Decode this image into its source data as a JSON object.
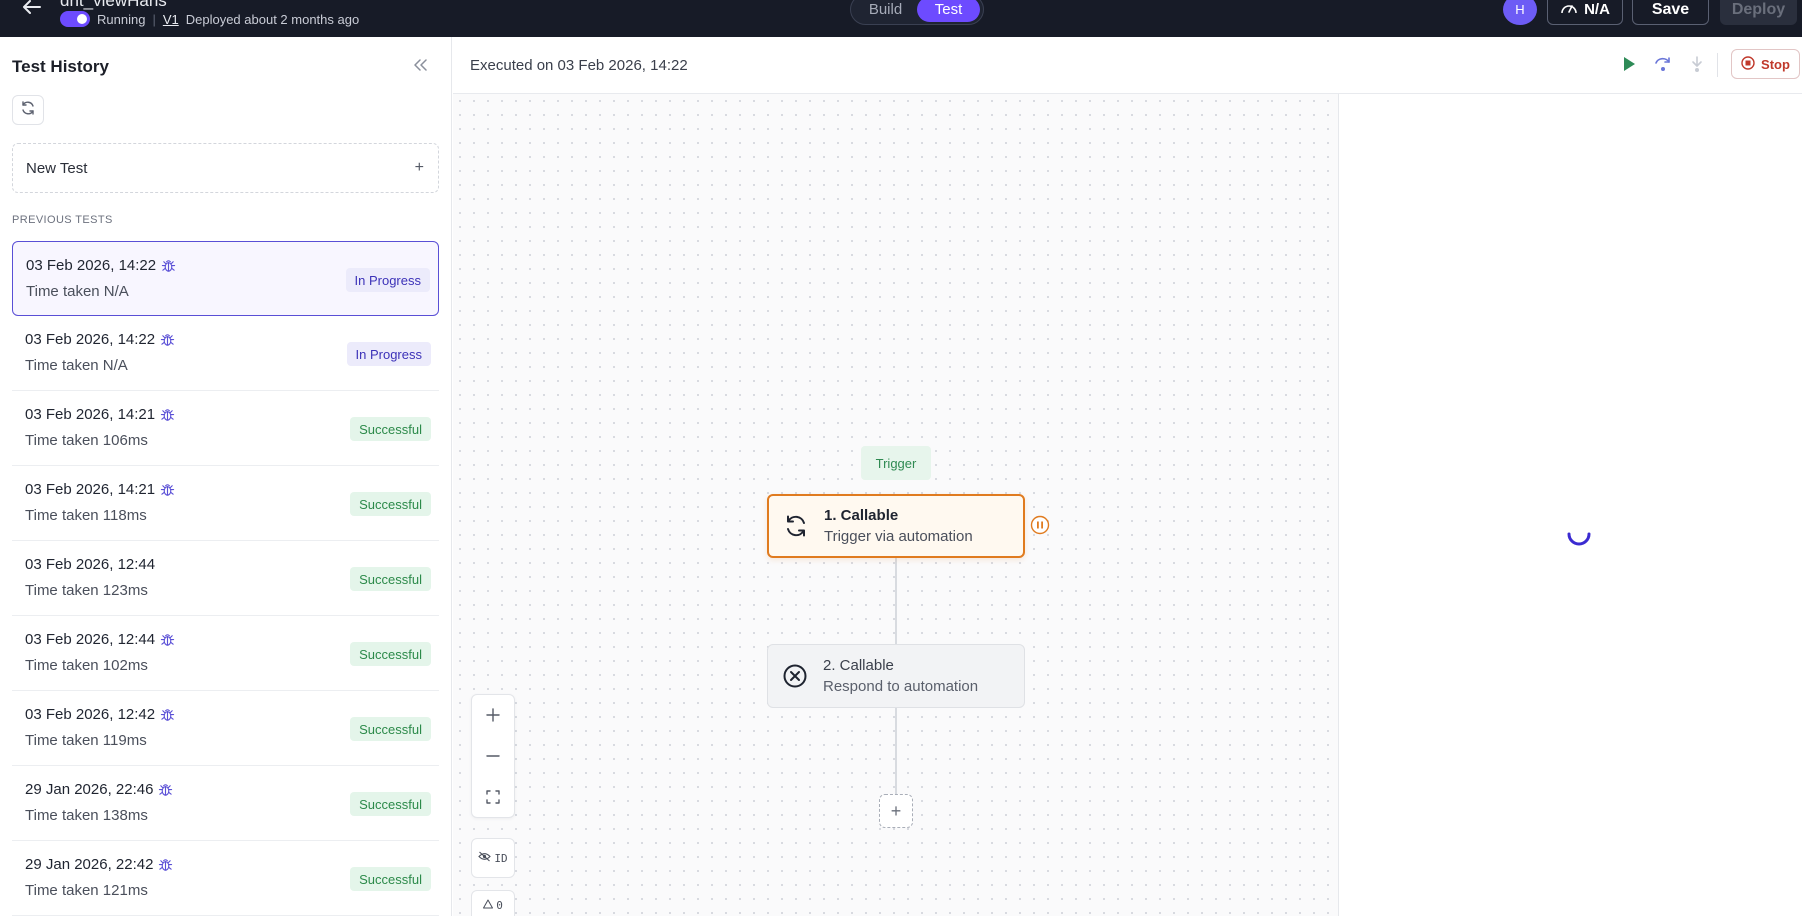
{
  "header": {
    "workflow_name": "dnt_viewHans",
    "status": "Running",
    "version": "V1",
    "deployed": "Deployed about 2 months ago",
    "tabs": [
      {
        "label": "Build",
        "active": false
      },
      {
        "label": "Test",
        "active": true
      }
    ],
    "avatar_initial": "H",
    "speed_label": "N/A",
    "save_label": "Save",
    "deploy_label": "Deploy",
    "accent_color": "#6d4bff"
  },
  "sidebar": {
    "title": "Test History",
    "new_test_label": "New Test",
    "section_label": "PREVIOUS TESTS",
    "tests": [
      {
        "date": "03 Feb 2026, 14:22",
        "time": "Time taken N/A",
        "status": "In Progress",
        "bug": true,
        "selected": true
      },
      {
        "date": "03 Feb 2026, 14:22",
        "time": "Time taken N/A",
        "status": "In Progress",
        "bug": true,
        "selected": false
      },
      {
        "date": "03 Feb 2026, 14:21",
        "time": "Time taken 106ms",
        "status": "Successful",
        "bug": true,
        "selected": false
      },
      {
        "date": "03 Feb 2026, 14:21",
        "time": "Time taken 118ms",
        "status": "Successful",
        "bug": true,
        "selected": false
      },
      {
        "date": "03 Feb 2026, 12:44",
        "time": "Time taken 123ms",
        "status": "Successful",
        "bug": false,
        "selected": false
      },
      {
        "date": "03 Feb 2026, 12:44",
        "time": "Time taken 102ms",
        "status": "Successful",
        "bug": true,
        "selected": false
      },
      {
        "date": "03 Feb 2026, 12:42",
        "time": "Time taken 119ms",
        "status": "Successful",
        "bug": true,
        "selected": false
      },
      {
        "date": "29 Jan 2026, 22:46",
        "time": "Time taken 138ms",
        "status": "Successful",
        "bug": true,
        "selected": false
      },
      {
        "date": "29 Jan 2026, 22:42",
        "time": "Time taken 121ms",
        "status": "Successful",
        "bug": true,
        "selected": false
      }
    ]
  },
  "canvas": {
    "executed_label": "Executed on 03 Feb 2026, 14:22",
    "stop_label": "Stop",
    "trigger_tag": "Trigger",
    "nodes": [
      {
        "title": "1. Callable",
        "subtitle": "Trigger via automation"
      },
      {
        "title": "2. Callable",
        "subtitle": "Respond to automation"
      }
    ],
    "id_toggle_label": "ID",
    "warning_count": "0"
  }
}
